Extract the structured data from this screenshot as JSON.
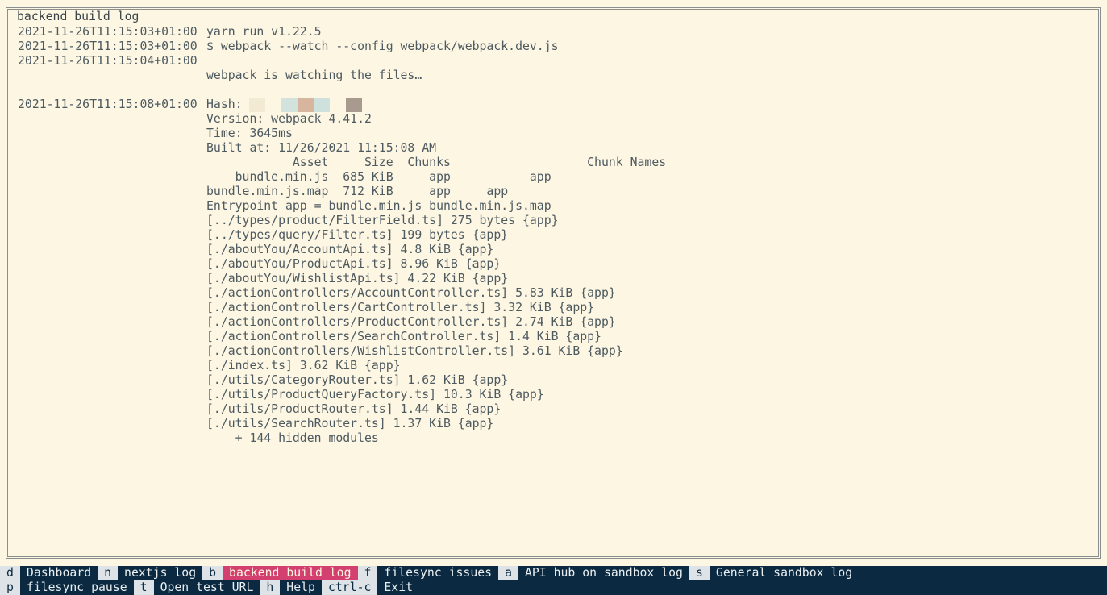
{
  "pane": {
    "title": "backend build log"
  },
  "log": [
    {
      "ts": "2021-11-26T11:15:03+01:00",
      "msg": "yarn run v1.22.5"
    },
    {
      "ts": "2021-11-26T11:15:03+01:00",
      "msg": "$ webpack --watch --config webpack/webpack.dev.js"
    },
    {
      "ts": "2021-11-26T11:15:04+01:00",
      "msg": ""
    },
    {
      "ts": "",
      "msg": "webpack is watching the files…"
    },
    {
      "ts": "",
      "msg": ""
    },
    {
      "ts": "2021-11-26T11:15:08+01:00",
      "msg": "Hash: "
    },
    {
      "ts": "",
      "msg": "Version: webpack 4.41.2"
    },
    {
      "ts": "",
      "msg": "Time: 3645ms"
    },
    {
      "ts": "",
      "msg": "Built at: 11/26/2021 11:15:08 AM"
    },
    {
      "ts": "",
      "msg": "            Asset     Size  Chunks                   Chunk Names"
    },
    {
      "ts": "",
      "msg": "    bundle.min.js  685 KiB     app           app"
    },
    {
      "ts": "",
      "msg": "bundle.min.js.map  712 KiB     app     app"
    },
    {
      "ts": "",
      "msg": "Entrypoint app = bundle.min.js bundle.min.js.map"
    },
    {
      "ts": "",
      "msg": "[../types/product/FilterField.ts] 275 bytes {app}"
    },
    {
      "ts": "",
      "msg": "[../types/query/Filter.ts] 199 bytes {app}"
    },
    {
      "ts": "",
      "msg": "[./aboutYou/AccountApi.ts] 4.8 KiB {app}"
    },
    {
      "ts": "",
      "msg": "[./aboutYou/ProductApi.ts] 8.96 KiB {app}"
    },
    {
      "ts": "",
      "msg": "[./aboutYou/WishlistApi.ts] 4.22 KiB {app}"
    },
    {
      "ts": "",
      "msg": "[./actionControllers/AccountController.ts] 5.83 KiB {app}"
    },
    {
      "ts": "",
      "msg": "[./actionControllers/CartController.ts] 3.32 KiB {app}"
    },
    {
      "ts": "",
      "msg": "[./actionControllers/ProductController.ts] 2.74 KiB {app}"
    },
    {
      "ts": "",
      "msg": "[./actionControllers/SearchController.ts] 1.4 KiB {app}"
    },
    {
      "ts": "",
      "msg": "[./actionControllers/WishlistController.ts] 3.61 KiB {app}"
    },
    {
      "ts": "",
      "msg": "[./index.ts] 3.62 KiB {app}"
    },
    {
      "ts": "",
      "msg": "[./utils/CategoryRouter.ts] 1.62 KiB {app}"
    },
    {
      "ts": "",
      "msg": "[./utils/ProductQueryFactory.ts] 10.3 KiB {app}"
    },
    {
      "ts": "",
      "msg": "[./utils/ProductRouter.ts] 1.44 KiB {app}"
    },
    {
      "ts": "",
      "msg": "[./utils/SearchRouter.ts] 1.37 KiB {app}"
    },
    {
      "ts": "",
      "msg": "    + 144 hidden modules"
    }
  ],
  "hash_colors": [
    "#f3ead3",
    "#fdf6e3",
    "#d2e3de",
    "#d8b59e",
    "#cfe1dd",
    "#fdf6e3",
    "#a99a90"
  ],
  "menu": {
    "row1": [
      {
        "key": "d",
        "label": "Dashboard",
        "active": false
      },
      {
        "key": "n",
        "label": "nextjs log",
        "active": false
      },
      {
        "key": "b",
        "label": "backend build log",
        "active": true
      },
      {
        "key": "f",
        "label": "filesync issues",
        "active": false
      },
      {
        "key": "a",
        "label": "API hub on sandbox log",
        "active": false
      },
      {
        "key": "s",
        "label": "General sandbox log",
        "active": false
      }
    ],
    "row2": [
      {
        "key": "p",
        "label": "filesync pause",
        "active": false
      },
      {
        "key": "t",
        "label": "Open test URL",
        "active": false
      },
      {
        "key": "h",
        "label": "Help",
        "active": false
      },
      {
        "key": "ctrl-c",
        "label": "Exit",
        "active": false
      }
    ]
  },
  "colors": {
    "background": "#fdf6e3",
    "menu_bg": "#0b2a42",
    "active_tab": "#d33f6e",
    "key_bg": "#dde3e6"
  }
}
